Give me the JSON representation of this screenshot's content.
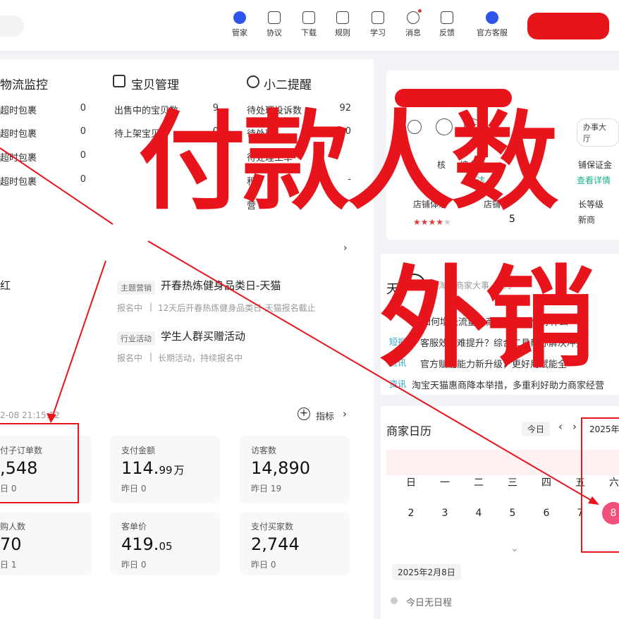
{
  "nav": {
    "items": [
      {
        "label": "管家",
        "icon": "butler-icon"
      },
      {
        "label": "协议",
        "icon": "agreement-icon"
      },
      {
        "label": "下载",
        "icon": "download-icon"
      },
      {
        "label": "规则",
        "icon": "rules-icon"
      },
      {
        "label": "学习",
        "icon": "learn-icon"
      },
      {
        "label": "消息",
        "icon": "message-icon"
      },
      {
        "label": "反馈",
        "icon": "feedback-icon"
      },
      {
        "label": "官方客服",
        "icon": "customer-service-icon"
      }
    ]
  },
  "logistics": {
    "title": "物流监控",
    "rows": [
      {
        "label": "超时包裹",
        "value": "0"
      },
      {
        "label": "超时包裹",
        "value": "0"
      },
      {
        "label": "超时包裹",
        "value": "0"
      },
      {
        "label": "超时包裹",
        "value": "0"
      }
    ]
  },
  "goods": {
    "title": "宝贝管理",
    "rows": [
      {
        "label": "出售中的宝贝数",
        "value": "9"
      },
      {
        "label": "待上架宝贝",
        "value": "0"
      }
    ]
  },
  "reminder": {
    "title": "小二提醒",
    "rows": [
      {
        "label": "待处理投诉数",
        "value": "92"
      },
      {
        "label": "待处理",
        "value": "0"
      },
      {
        "label": "待处理工单",
        "value": ""
      },
      {
        "label": "积",
        "value": "-"
      },
      {
        "label": "营",
        "value": ""
      }
    ]
  },
  "left_partial": {
    "label": "红"
  },
  "campaigns": [
    {
      "tag": "主题营销",
      "title": "开春热炼健身品类日-天猫",
      "status": "报名中",
      "desc": "12天后开春热炼健身品类日-天猫报名截止"
    },
    {
      "tag": "行业活动",
      "title": "学生人群买赠活动",
      "status": "报名中",
      "desc": "长期活动，持续报名中"
    }
  ],
  "data_section": {
    "timestamp": "2-08 21:15:12",
    "indicator_label": "指标",
    "cards": [
      {
        "label": "付子订单数",
        "value": ",548",
        "unit": "",
        "sub": "日 0"
      },
      {
        "label": "支付金额",
        "value": "114.",
        "decimal": "99",
        "unit": "万",
        "sub": "昨日 0"
      },
      {
        "label": "访客数",
        "value": "14,890",
        "unit": "",
        "sub": "昨日 19"
      },
      {
        "label": "购人数",
        "value": "70",
        "unit": "",
        "sub": "日 1"
      },
      {
        "label": "客单价",
        "value": "419.",
        "decimal": "05",
        "unit": "",
        "sub": "昨日 0"
      },
      {
        "label": "支付买家数",
        "value": "2,744",
        "unit": "",
        "sub": "昨日 0"
      }
    ]
  },
  "shop_panel": {
    "office_button": "办事大厅",
    "metrics": [
      {
        "label": "核",
        "sub": ""
      },
      {
        "label": "综合资",
        "sub": "达"
      },
      {
        "label": "铺保证金",
        "sub": "查看详情"
      }
    ],
    "row2": [
      {
        "label": "店铺体系",
        "value": ""
      },
      {
        "label": "店铺",
        "value": "5"
      },
      {
        "label": "长等级",
        "value": "新商"
      }
    ],
    "stars": 4
  },
  "news": {
    "title": "天",
    "subtitle": "淘宝商家大事，上手",
    "items": [
      {
        "tag": "",
        "text": "如何增长流量？商家淘宝该做好什么"
      },
      {
        "tag": "短视",
        "text": "客服效率难提升？综合工具帮你解决冲突"
      },
      {
        "tag": "资讯",
        "text": "官方赋能能力新升级，更好用赋能全"
      },
      {
        "tag": "资讯",
        "text": "淘宝天猫惠商降本举措，多重利好助力商家经营"
      }
    ]
  },
  "calendar": {
    "title": "商家日历",
    "today_button": "今日",
    "month_label": "2025年",
    "weekdays": [
      "日",
      "一",
      "二",
      "三",
      "四",
      "五",
      "六"
    ],
    "days": [
      "2",
      "3",
      "4",
      "5",
      "6",
      "7",
      "8"
    ],
    "selected_date": "2025年2月8日",
    "empty_text": "今日无日程"
  },
  "overlay": {
    "headline1": "付款人数",
    "headline2": "外销"
  },
  "colors": {
    "accent_red": "#e8141c",
    "brand_blue": "#2f54eb",
    "calendar_pink": "#f0507a"
  }
}
